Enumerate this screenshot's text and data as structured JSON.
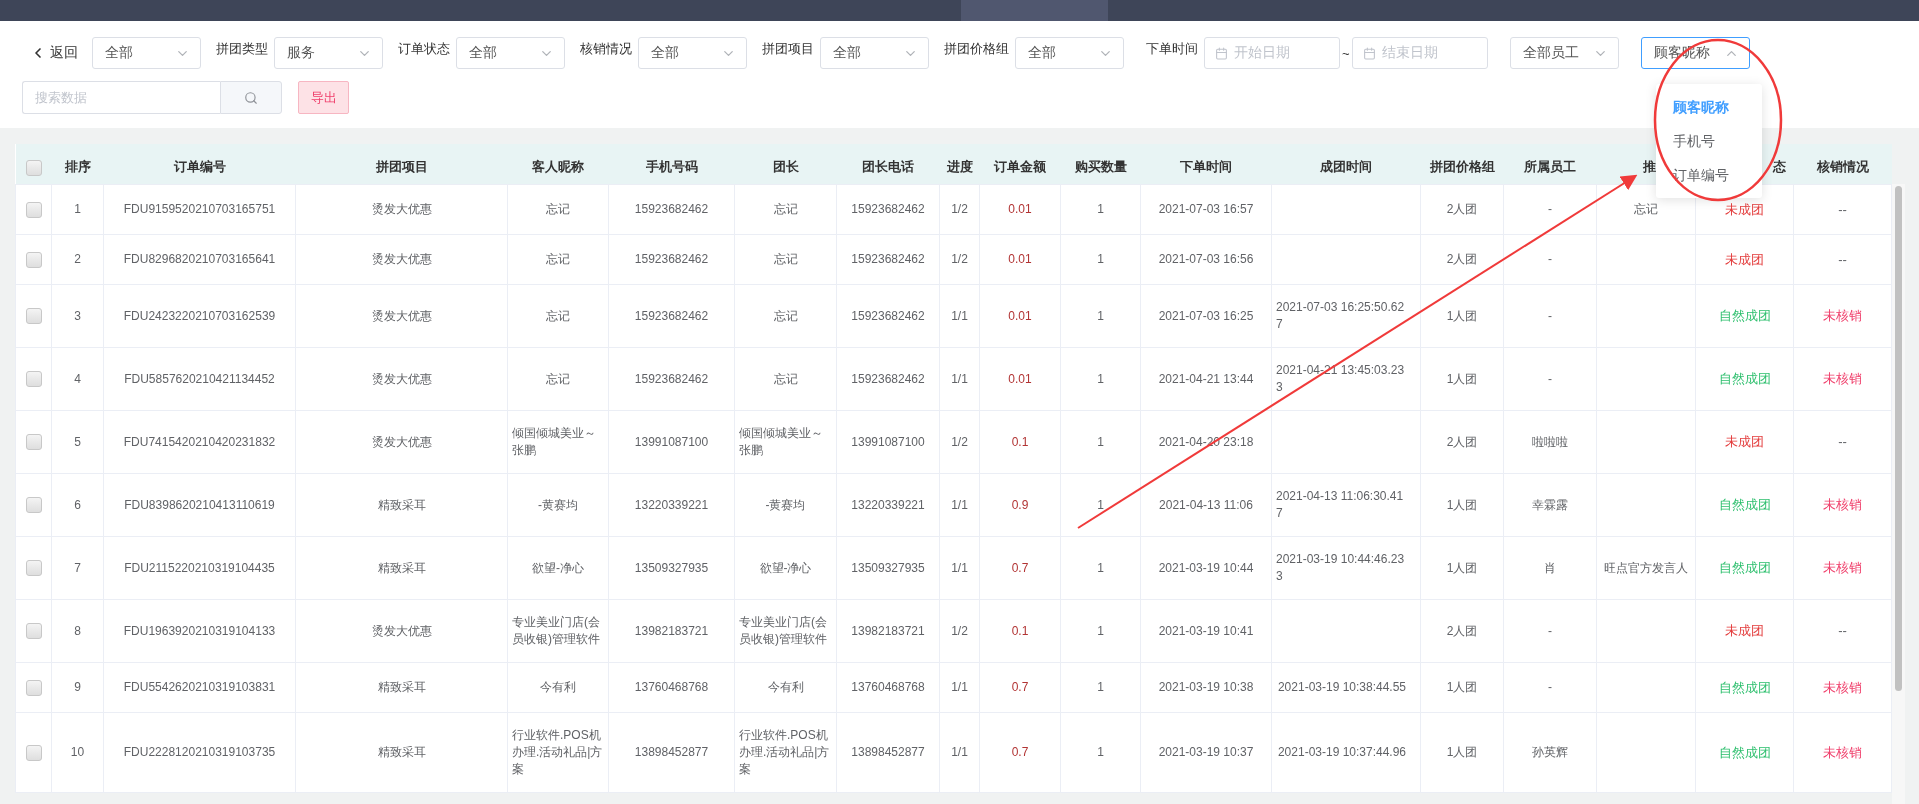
{
  "filters": [
    {
      "kind": "back",
      "label": "返回"
    },
    {
      "kind": "select",
      "value": "全部"
    },
    {
      "kind": "select",
      "label": "拼团类型",
      "value": "服务"
    },
    {
      "kind": "select",
      "label": "订单状态",
      "value": "全部"
    },
    {
      "kind": "select",
      "label": "核销情况",
      "value": "全部"
    },
    {
      "kind": "select",
      "label": "拼团项目",
      "value": "全部"
    },
    {
      "kind": "select",
      "label": "拼团价格组",
      "value": "全部"
    },
    {
      "kind": "daterange",
      "label": "下单时间",
      "start_placeholder": "开始日期",
      "separator": "~",
      "end_placeholder": "结束日期"
    },
    {
      "kind": "select",
      "value": "全部员工"
    },
    {
      "kind": "select",
      "value": "顾客昵称",
      "expanded": true,
      "options": [
        {
          "label": "顾客昵称",
          "selected": true
        },
        {
          "label": "手机号",
          "selected": false
        },
        {
          "label": "订单编号",
          "selected": false
        }
      ]
    }
  ],
  "search": {
    "placeholder": "搜索数据"
  },
  "export_button": "导出",
  "table": {
    "select_all_checked": false,
    "columns": [
      "排序",
      "订单编号",
      "拼团项目",
      "客人昵称",
      "手机号码",
      "团长",
      "团长电话",
      "进度",
      "订单金额",
      "购买数量",
      "下单时间",
      "成团时间",
      "拼团价格组",
      "所属员工",
      "推",
      "态",
      "核销情况"
    ],
    "rows": [
      {
        "checked": false,
        "index": "1",
        "order_no": "FDU9159520210703165751",
        "project": "烫发大优惠",
        "customer": "忘记",
        "phone": "15923682462",
        "leader": "忘记",
        "leader_phone": "15923682462",
        "progress": "1/2",
        "amount": "0.01",
        "qty": "1",
        "order_time": "2021-07-03 16:57",
        "price_group": "2人团",
        "staff": "-",
        "referrer": "忘记",
        "status": {
          "text": "未成团",
          "color": "#e33b3b"
        },
        "verify": {
          "text": "--",
          "color": "#606266"
        }
      },
      {
        "checked": false,
        "index": "2",
        "order_no": "FDU8296820210703165641",
        "project": "烫发大优惠",
        "customer": "忘记",
        "phone": "15923682462",
        "leader": "忘记",
        "leader_phone": "15923682462",
        "progress": "1/2",
        "amount": "0.01",
        "qty": "1",
        "order_time": "2021-07-03 16:56",
        "price_group": "2人团",
        "staff": "-",
        "status": {
          "text": "未成团",
          "color": "#e33b3b"
        },
        "verify": {
          "text": "--",
          "color": "#606266"
        }
      },
      {
        "checked": false,
        "index": "3",
        "order_no": "FDU2423220210703162539",
        "project": "烫发大优惠",
        "customer": "忘记",
        "phone": "15923682462",
        "leader": "忘记",
        "leader_phone": "15923682462",
        "progress": "1/1",
        "amount": "0.01",
        "qty": "1",
        "order_time": "2021-07-03 16:25",
        "formed_time": "2021-07-03 16:25:50.627",
        "price_group": "1人团",
        "staff": "-",
        "status": {
          "text": "自然成团",
          "color": "#2dbf6d"
        },
        "verify": {
          "text": "未核销",
          "color": "#f0406c"
        }
      },
      {
        "checked": false,
        "index": "4",
        "order_no": "FDU5857620210421134452",
        "project": "烫发大优惠",
        "customer": "忘记",
        "phone": "15923682462",
        "leader": "忘记",
        "leader_phone": "15923682462",
        "progress": "1/1",
        "amount": "0.01",
        "qty": "1",
        "order_time": "2021-04-21 13:44",
        "formed_time": "2021-04-21 13:45:03.233",
        "price_group": "1人团",
        "staff": "-",
        "status": {
          "text": "自然成团",
          "color": "#2dbf6d"
        },
        "verify": {
          "text": "未核销",
          "color": "#f0406c"
        }
      },
      {
        "checked": false,
        "index": "5",
        "order_no": "FDU7415420210420231832",
        "project": "烫发大优惠",
        "customer": "倾国倾城美业～张鹏",
        "phone": "13991087100",
        "leader": "倾国倾城美业～张鹏",
        "leader_phone": "13991087100",
        "progress": "1/2",
        "amount": "0.1",
        "qty": "1",
        "order_time": "2021-04-20 23:18",
        "price_group": "2人团",
        "staff": "啦啦啦",
        "status": {
          "text": "未成团",
          "color": "#e33b3b"
        },
        "verify": {
          "text": "--",
          "color": "#606266"
        }
      },
      {
        "checked": false,
        "index": "6",
        "order_no": "FDU8398620210413110619",
        "project": "精致采耳",
        "customer": "-黄赛均",
        "phone": "13220339221",
        "leader": "-黄赛均",
        "leader_phone": "13220339221",
        "progress": "1/1",
        "amount": "0.9",
        "qty": "1",
        "order_time": "2021-04-13 11:06",
        "formed_time": "2021-04-13 11:06:30.417",
        "price_group": "1人团",
        "staff": "幸霖露",
        "status": {
          "text": "自然成团",
          "color": "#2dbf6d"
        },
        "verify": {
          "text": "未核销",
          "color": "#f0406c"
        }
      },
      {
        "checked": false,
        "index": "7",
        "order_no": "FDU2115220210319104435",
        "project": "精致采耳",
        "customer": "欲望-净心",
        "phone": "13509327935",
        "leader": "欲望-净心",
        "leader_phone": "13509327935",
        "progress": "1/1",
        "amount": "0.7",
        "qty": "1",
        "order_time": "2021-03-19 10:44",
        "formed_time": "2021-03-19 10:44:46.233",
        "price_group": "1人团",
        "staff": "肖",
        "referrer": "旺点官方发言人",
        "status": {
          "text": "自然成团",
          "color": "#2dbf6d"
        },
        "verify": {
          "text": "未核销",
          "color": "#f0406c"
        }
      },
      {
        "checked": false,
        "index": "8",
        "order_no": "FDU1963920210319104133",
        "project": "烫发大优惠",
        "customer": "专业美业门店(会员收银)管理软件",
        "phone": "13982183721",
        "leader": "专业美业门店(会员收银)管理软件",
        "leader_phone": "13982183721",
        "progress": "1/2",
        "amount": "0.1",
        "qty": "1",
        "order_time": "2021-03-19 10:41",
        "price_group": "2人团",
        "staff": "-",
        "status": {
          "text": "未成团",
          "color": "#e33b3b"
        },
        "verify": {
          "text": "--",
          "color": "#606266"
        }
      },
      {
        "checked": false,
        "index": "9",
        "order_no": "FDU5542620210319103831",
        "project": "精致采耳",
        "customer": "今有利",
        "phone": "13760468768",
        "leader": "今有利",
        "leader_phone": "13760468768",
        "progress": "1/1",
        "amount": "0.7",
        "qty": "1",
        "order_time": "2021-03-19 10:38",
        "formed_time": "2021-03-19 10:38:44.55",
        "price_group": "1人团",
        "staff": "-",
        "status": {
          "text": "自然成团",
          "color": "#2dbf6d"
        },
        "verify": {
          "text": "未核销",
          "color": "#f0406c"
        }
      },
      {
        "checked": false,
        "index": "10",
        "order_no": "FDU2228120210319103735",
        "project": "精致采耳",
        "customer": "行业软件.POS机办理.活动礼品|方案",
        "phone": "13898452877",
        "leader": "行业软件.POS机办理.活动礼品|方案",
        "leader_phone": "13898452877",
        "progress": "1/1",
        "amount": "0.7",
        "qty": "1",
        "order_time": "2021-03-19 10:37",
        "formed_time": "2021-03-19 10:37:44.96",
        "price_group": "1人团",
        "staff": "孙英辉",
        "status": {
          "text": "自然成团",
          "color": "#2dbf6d"
        },
        "verify": {
          "text": "未核销",
          "color": "#f0406c"
        }
      }
    ]
  },
  "annotation": {
    "kind": "circle-with-arrow"
  }
}
